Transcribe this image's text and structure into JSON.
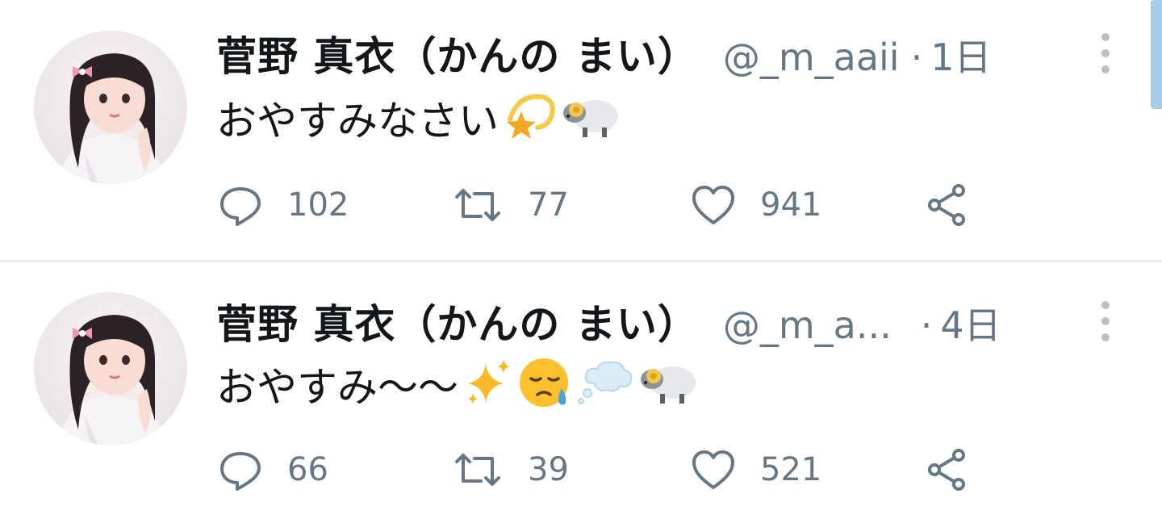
{
  "colors": {
    "text_primary": "#14171a",
    "text_secondary": "#657786",
    "divider": "#e6ecf0",
    "scroll_accent": "#a8cdea"
  },
  "tweets": [
    {
      "display_name": "菅野 真衣（かんの まい）",
      "handle": "@_m_aaii",
      "separator": "·",
      "time": "1日",
      "text": "おやすみなさい",
      "emojis": [
        "dizzy-star-emoji",
        "ram-emoji"
      ],
      "reply_count": "102",
      "retweet_count": "77",
      "like_count": "941",
      "icons": [
        "more-vertical-icon",
        "reply-icon",
        "retweet-icon",
        "heart-icon",
        "share-icon"
      ]
    },
    {
      "display_name": "菅野 真衣（かんの まい）",
      "handle": "@_m_a...",
      "separator": "·",
      "time": "4日",
      "text": "おやすみ〜〜",
      "emojis": [
        "sparkles-emoji",
        "sleepy-face-emoji",
        "thought-balloon-emoji",
        "ram-emoji"
      ],
      "reply_count": "66",
      "retweet_count": "39",
      "like_count": "521",
      "icons": [
        "more-vertical-icon",
        "reply-icon",
        "retweet-icon",
        "heart-icon",
        "share-icon"
      ]
    }
  ]
}
